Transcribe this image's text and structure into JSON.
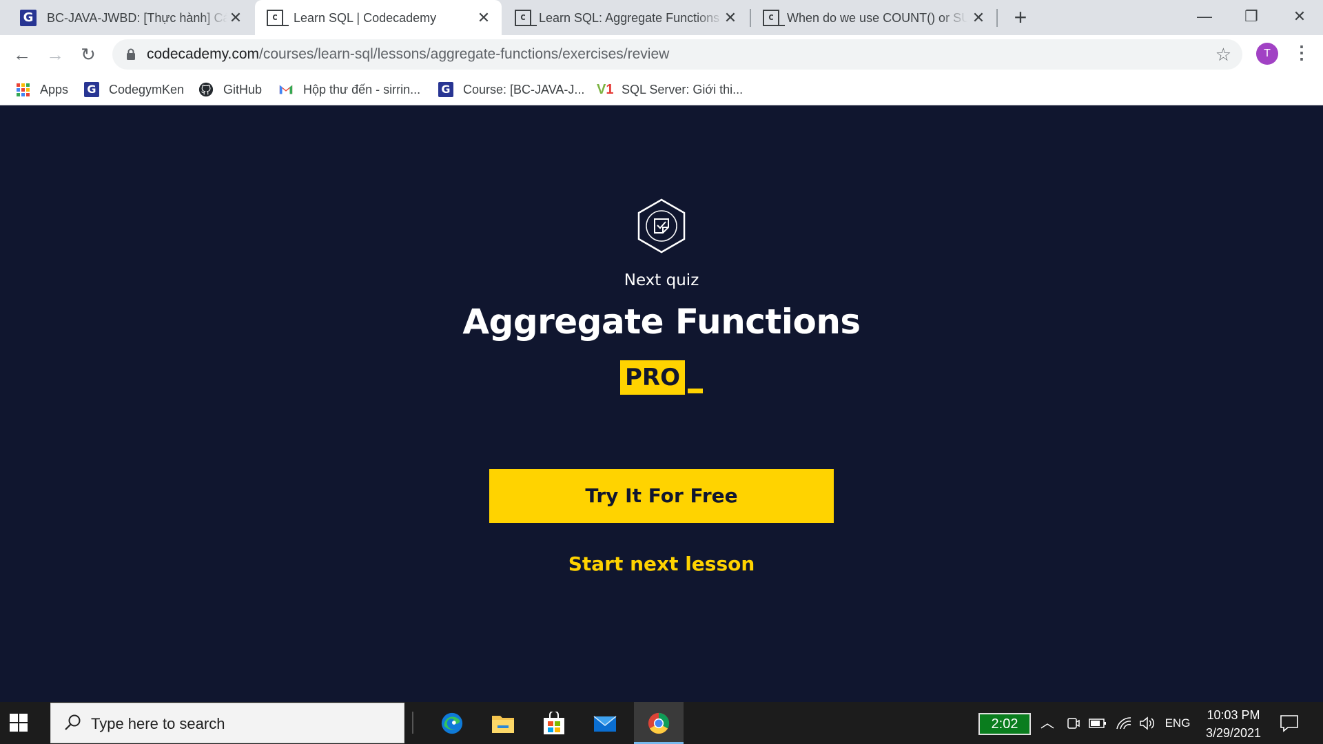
{
  "browser": {
    "tabs": [
      {
        "title": "BC-JAVA-JWBD: [Thực hành] Các",
        "favicon": "codegym-icon",
        "active": false
      },
      {
        "title": "Learn SQL | Codecademy",
        "favicon": "codecademy-icon",
        "active": true
      },
      {
        "title": "Learn SQL: Aggregate Functions",
        "favicon": "codecademy-icon",
        "active": false
      },
      {
        "title": "When do we use COUNT() or SUM",
        "favicon": "codecademy-icon",
        "active": false
      }
    ],
    "new_tab_glyph": "+",
    "window_controls": {
      "minimize": "—",
      "restore": "❐",
      "close": "✕"
    },
    "nav": {
      "back": "←",
      "forward": "→",
      "reload": "↻"
    },
    "url_host": "codecademy.com",
    "url_path": "/courses/learn-sql/lessons/aggregate-functions/exercises/review",
    "bookmark_star": "☆",
    "profile_initial": "T",
    "profile_color": "#a142c4",
    "menu_glyph": "⋮",
    "bookmarks": [
      {
        "label": "Apps",
        "icon": "apps-grid-icon"
      },
      {
        "label": "CodegymKen",
        "icon": "codegym-icon"
      },
      {
        "label": "GitHub",
        "icon": "github-icon"
      },
      {
        "label": "Hộp thư đến - sirrin...",
        "icon": "gmail-icon"
      },
      {
        "label": "Course: [BC-JAVA-J...",
        "icon": "codegym-icon"
      },
      {
        "label": "SQL Server: Giới thi...",
        "icon": "v1-icon"
      }
    ]
  },
  "page": {
    "background": "#10162f",
    "accent": "#ffd300",
    "quiz_icon": "hexagon-quiz-icon",
    "next_label": "Next quiz",
    "title": "Aggregate Functions",
    "badge": "PRO",
    "cta": "Try It For Free",
    "secondary_link": "Start next lesson"
  },
  "taskbar": {
    "search_placeholder": "Type here to search",
    "apps": [
      "edge-icon",
      "file-explorer-icon",
      "store-icon",
      "mail-icon",
      "chrome-icon"
    ],
    "timer": "2:02",
    "language": "ENG",
    "time": "10:03 PM",
    "date": "3/29/2021"
  }
}
